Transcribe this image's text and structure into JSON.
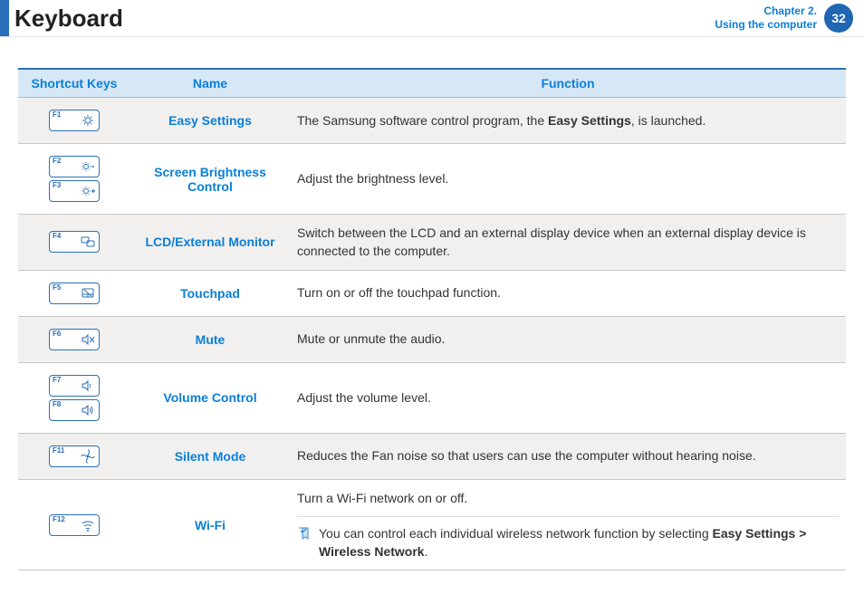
{
  "header": {
    "title": "Keyboard",
    "chapter_line1": "Chapter 2.",
    "chapter_line2": "Using the computer",
    "page_number": "32"
  },
  "table": {
    "headers": {
      "keys": "Shortcut Keys",
      "name": "Name",
      "func": "Function"
    },
    "rows": [
      {
        "keys": [
          {
            "label": "F1",
            "icon": "gear"
          }
        ],
        "name": "Easy Settings",
        "func_pre": "The Samsung software control program, the ",
        "func_bold": "Easy Settings",
        "func_post": ", is launched.",
        "alt": true
      },
      {
        "keys": [
          {
            "label": "F2",
            "icon": "bright-minus"
          },
          {
            "label": "F3",
            "icon": "bright-plus"
          }
        ],
        "name": "Screen Brightness Control",
        "func_text": "Adjust the brightness level.",
        "alt": false
      },
      {
        "keys": [
          {
            "label": "F4",
            "icon": "monitor-swap"
          }
        ],
        "name": "LCD/External Monitor",
        "func_text": "Switch between the LCD and an external display device when an external display device is connected to the computer.",
        "alt": true
      },
      {
        "keys": [
          {
            "label": "F5",
            "icon": "touchpad"
          }
        ],
        "name": "Touchpad",
        "func_text": "Turn on or off the touchpad function.",
        "alt": false
      },
      {
        "keys": [
          {
            "label": "F6",
            "icon": "mute"
          }
        ],
        "name": "Mute",
        "func_text": "Mute or unmute the audio.",
        "alt": true
      },
      {
        "keys": [
          {
            "label": "F7",
            "icon": "vol-down"
          },
          {
            "label": "F8",
            "icon": "vol-up"
          }
        ],
        "name": "Volume Control",
        "func_text": "Adjust the volume level.",
        "alt": false
      },
      {
        "keys": [
          {
            "label": "F11",
            "icon": "fan"
          }
        ],
        "name": "Silent Mode",
        "func_text": "Reduces the Fan noise so that users can use the computer without hearing noise.",
        "alt": true
      },
      {
        "keys": [
          {
            "label": "F12",
            "icon": "wifi"
          }
        ],
        "name": "Wi-Fi",
        "func_text": "Turn a Wi-Fi network on or off.",
        "note_pre": "You can control each individual wireless network function by selecting ",
        "note_bold": "Easy Settings > Wireless Network",
        "note_post": ".",
        "alt": false
      }
    ]
  }
}
